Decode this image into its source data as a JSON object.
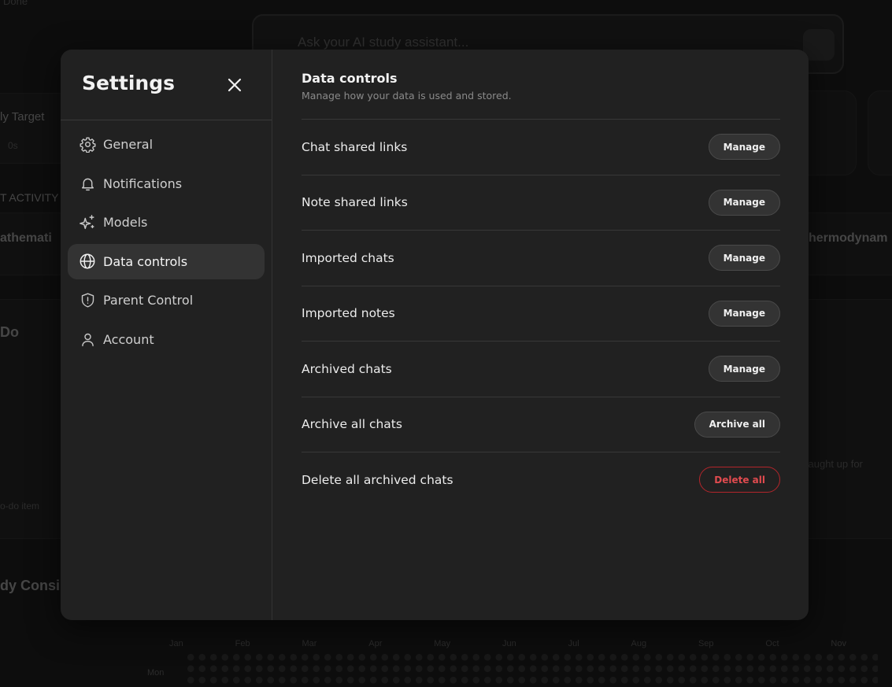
{
  "background": {
    "search_placeholder": "Ask your AI study assistant...",
    "fragments": [
      "Done",
      "ly Target",
      "0s",
      "T ACTIVITY",
      "athemati",
      "Do",
      "hermodynam",
      "caught up for",
      "o-do item",
      "dy Consi"
    ],
    "months": [
      "Jan",
      "Feb",
      "Mar",
      "Apr",
      "May",
      "Jun",
      "Jul",
      "Aug",
      "Sep",
      "Oct",
      "Nov"
    ],
    "day_label": "Mon"
  },
  "modal": {
    "title": "Settings",
    "close_icon": "close-icon",
    "nav": [
      {
        "label": "General",
        "icon": "gear-icon",
        "active": false
      },
      {
        "label": "Notifications",
        "icon": "bell-icon",
        "active": false
      },
      {
        "label": "Models",
        "icon": "sparkles-icon",
        "active": false
      },
      {
        "label": "Data controls",
        "icon": "globe-icon",
        "active": true
      },
      {
        "label": "Parent Control",
        "icon": "shield-alert-icon",
        "active": false
      },
      {
        "label": "Account",
        "icon": "user-icon",
        "active": false
      }
    ],
    "section": {
      "title": "Data controls",
      "subtitle": "Manage how your data is used and stored."
    },
    "rows": [
      {
        "label": "Chat shared links",
        "button": "Manage"
      },
      {
        "label": "Note shared links",
        "button": "Manage"
      },
      {
        "label": "Imported chats",
        "button": "Manage"
      },
      {
        "label": "Imported notes",
        "button": "Manage"
      },
      {
        "label": "Archived chats",
        "button": "Manage"
      },
      {
        "label": "Archive all chats",
        "button": "Archive all"
      },
      {
        "label": "Delete all archived chats",
        "button": "Delete all"
      }
    ],
    "colors": {
      "panel": "#212121",
      "active_nav": "#333333",
      "danger": "#e14b4f"
    }
  }
}
